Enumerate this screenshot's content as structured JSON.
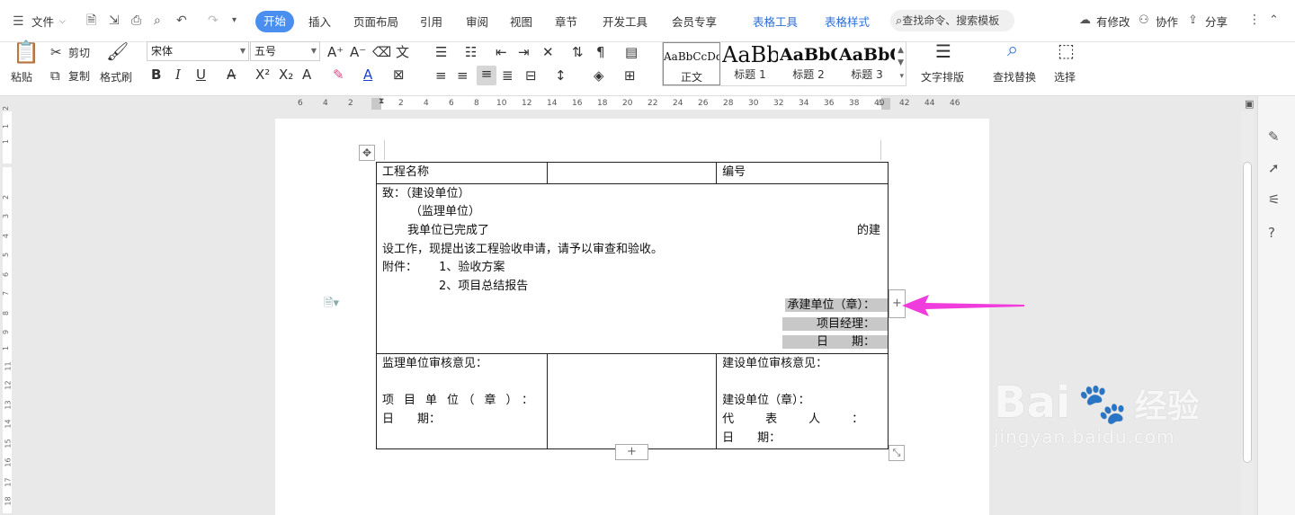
{
  "menubar": {
    "file_label": "文件",
    "tabs": [
      "开始",
      "插入",
      "页面布局",
      "引用",
      "审阅",
      "视图",
      "章节",
      "开发工具",
      "会员专享"
    ],
    "context_tabs": [
      "表格工具",
      "表格样式"
    ],
    "search_placeholder": "查找命令、搜索模板",
    "modified_label": "有修改",
    "collab_label": "协作",
    "share_label": "分享"
  },
  "toolbar": {
    "paste": "粘贴",
    "cut": "剪切",
    "copy": "复制",
    "format_painter": "格式刷",
    "font_name": "宋体",
    "font_size": "五号",
    "bold": "B",
    "italic": "I",
    "underline": "U",
    "styles": [
      {
        "sample": "AaBbCcDd",
        "name": "正文"
      },
      {
        "sample": "AaBb",
        "name": "标题 1"
      },
      {
        "sample": "AaBbC",
        "name": "标题 2"
      },
      {
        "sample": "AaBbC",
        "name": "标题 3"
      }
    ],
    "text_layout": "文字排版",
    "find_replace": "查找替换",
    "select": "选择"
  },
  "ruler": [
    "6",
    "4",
    "2",
    "2",
    "4",
    "6",
    "8",
    "10",
    "12",
    "14",
    "16",
    "18",
    "20",
    "22",
    "24",
    "26",
    "28",
    "30",
    "32",
    "34",
    "36",
    "38",
    "40",
    "42",
    "44",
    "46"
  ],
  "vruler": [
    "2",
    "1",
    "1",
    "2",
    "3",
    "4",
    "5",
    "6",
    "7",
    "8",
    "9",
    "1",
    "11",
    "12",
    "13",
    "14",
    "15",
    "16",
    "17",
    "18"
  ],
  "doc": {
    "r1": {
      "c1": "工程名称",
      "c2": "",
      "c3": "编号"
    },
    "body": {
      "l1": "致：（建设单位）",
      "l2": "（监理单位）",
      "l3a": "我单位已完成了",
      "l3b": "的建",
      "l4": "设工作，现提出该工程验收申请，请予以审查和验收。",
      "l5a": "附件：",
      "l5b": "1、验收方案",
      "l6": "2、项目总结报告",
      "s1": "承建单位（章）：",
      "s2": "项目经理：",
      "s3": "日　　期："
    },
    "bottom": {
      "a1": "监理单位审核意见：",
      "a2": "项　目　单　位　（　章　）　：",
      "a3": "日　　期：",
      "b1": "建设单位审核意见：",
      "b2": "建设单位（章）：",
      "b3": "代　　　表　　　人　　　：",
      "b4": "日　　期："
    }
  },
  "watermark": {
    "brand": "Bai",
    "brand2": "经验",
    "url": "jingyan.baidu.com"
  },
  "colors": {
    "accent": "#4a8ef0",
    "arrow": "#f03cdc"
  }
}
